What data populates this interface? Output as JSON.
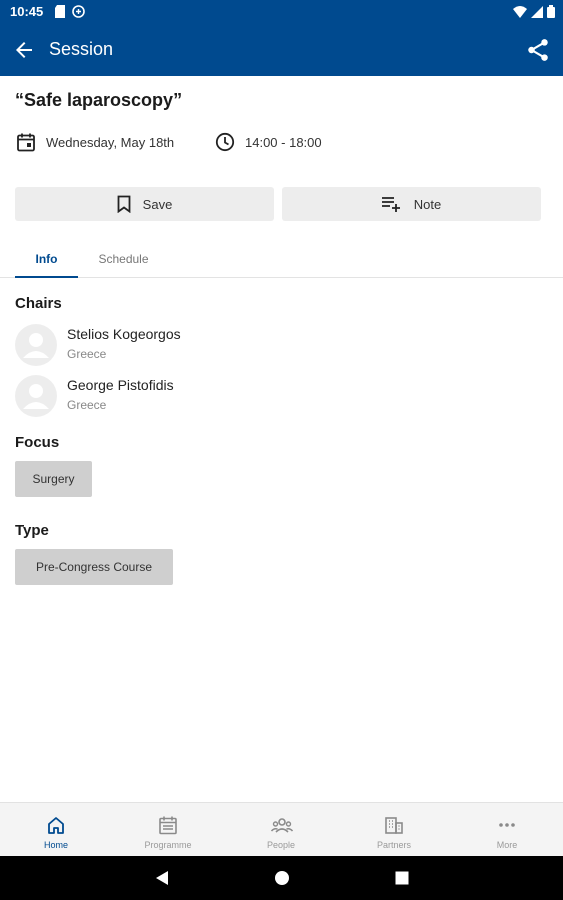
{
  "status_bar": {
    "time": "10:45"
  },
  "app_bar": {
    "title": "Session"
  },
  "session": {
    "title": "“Safe laparoscopy”",
    "date": "Wednesday, May 18th",
    "time_range": "14:00 - 18:00"
  },
  "actions": {
    "save_label": "Save",
    "note_label": "Note"
  },
  "tabs": [
    {
      "label": "Info",
      "active": true
    },
    {
      "label": "Schedule",
      "active": false
    }
  ],
  "chairs": {
    "heading": "Chairs",
    "people": [
      {
        "name": "Stelios Kogeorgos",
        "country": "Greece"
      },
      {
        "name": "George Pistofidis",
        "country": "Greece"
      }
    ]
  },
  "focus": {
    "heading": "Focus",
    "tag": "Surgery"
  },
  "type": {
    "heading": "Type",
    "tag": "Pre-Congress Course"
  },
  "bottom_nav": [
    {
      "label": "Home",
      "icon": "home-icon",
      "active": true
    },
    {
      "label": "Programme",
      "icon": "calendar-icon",
      "active": false
    },
    {
      "label": "People",
      "icon": "people-icon",
      "active": false
    },
    {
      "label": "Partners",
      "icon": "building-icon",
      "active": false
    },
    {
      "label": "More",
      "icon": "more-icon",
      "active": false
    }
  ],
  "colors": {
    "primary": "#004a8f",
    "chip": "#cfcfcf",
    "button": "#ededed"
  }
}
